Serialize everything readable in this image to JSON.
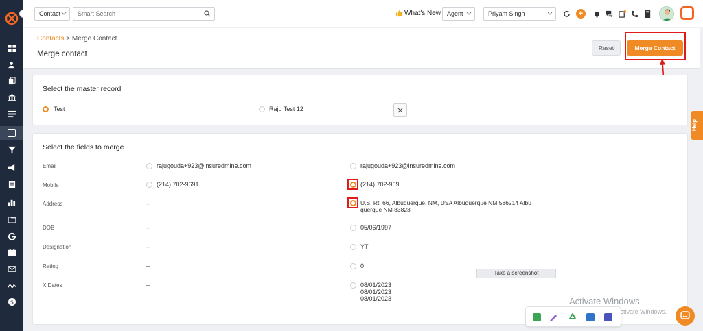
{
  "topbar": {
    "contact_select": "Contact",
    "search_placeholder": "Smart Search",
    "whats_new": "What's New",
    "role_select": "Agent",
    "user_select": "Priyam Singh"
  },
  "header": {
    "breadcrumb_link": "Contacts",
    "breadcrumb_sep": ">",
    "breadcrumb_current": "Merge Contact",
    "title": "Merge contact",
    "reset_label": "Reset",
    "merge_label": "Merge Contact"
  },
  "master": {
    "title": "Select the master record",
    "options": [
      "Test",
      "Raju Test 12"
    ],
    "selected": 0
  },
  "fields": {
    "title": "Select the fields to merge",
    "rows": [
      {
        "label": "Email",
        "left": "rajugouda+923@insuredmine.com",
        "right": "rajugouda+923@insuredmine.com"
      },
      {
        "label": "Mobile",
        "left": "(214) 702-9691",
        "right": "(214) 702-969"
      },
      {
        "label": "Address",
        "left": "–",
        "right_line1": "U.S. Rt. 66, Albuquerque, NM, USA Albuquerque NM 586214 Albu",
        "right_line2": "querque NM 83823"
      },
      {
        "label": "DOB",
        "left": "–",
        "right": "05/06/1997"
      },
      {
        "label": "Designation",
        "left": "–",
        "right": "YT"
      },
      {
        "label": "Rating",
        "left": "–",
        "right": "0"
      },
      {
        "label": "X Dates",
        "left": "–",
        "right_dates": [
          "08/01/2023",
          "08/01/2023",
          "08/01/2023"
        ]
      }
    ]
  },
  "help_label": "Help",
  "tooltip": "Take a screenshot",
  "watermark": {
    "line1": "Activate Windows",
    "line2": "Go to Settings to activate Windows."
  },
  "colors": {
    "accent": "#f08a24",
    "sidebar": "#1f2a3c",
    "highlight": "#e01b1b"
  }
}
